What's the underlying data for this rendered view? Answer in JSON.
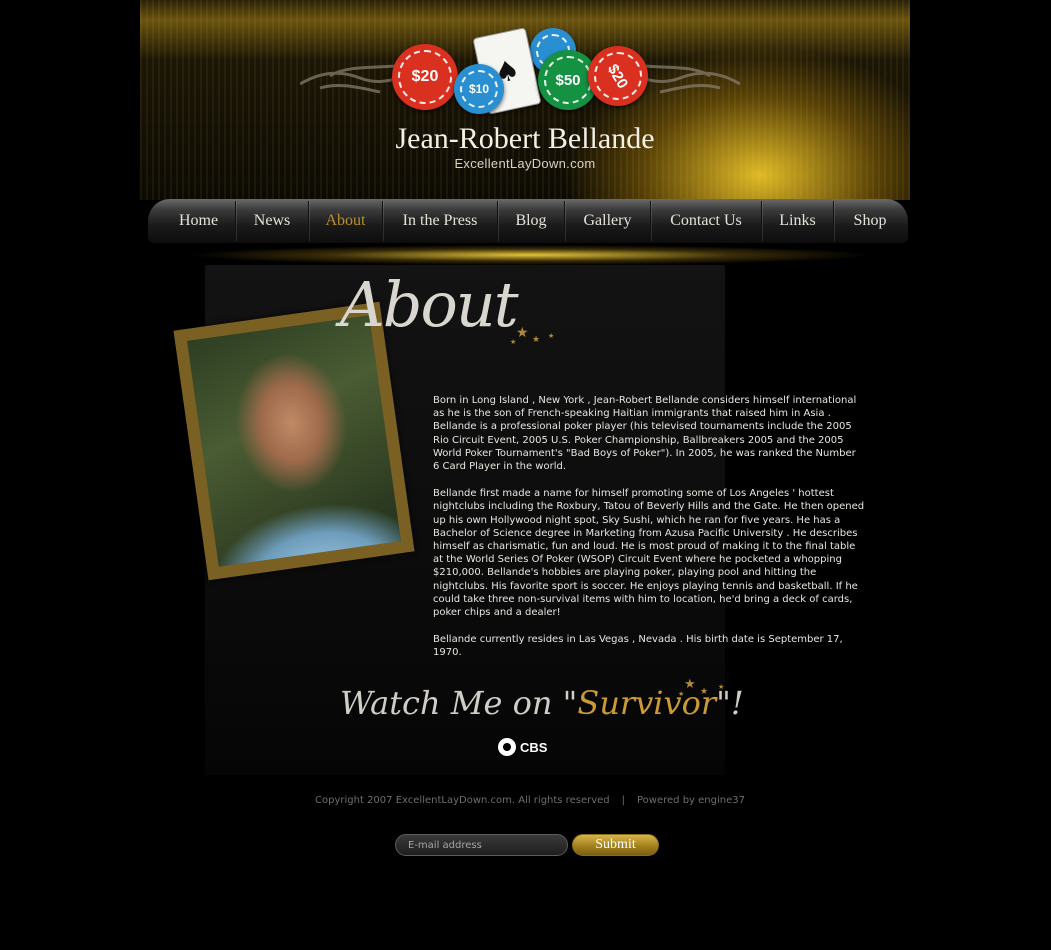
{
  "header": {
    "title": "Jean-Robert Bellande",
    "subtitle": "ExcellentLayDown.com",
    "chips": [
      "$20",
      "$10",
      "$50",
      "$20"
    ],
    "card_symbol": "♠"
  },
  "nav": {
    "items": [
      {
        "label": "Home",
        "active": false
      },
      {
        "label": "News",
        "active": false
      },
      {
        "label": "About",
        "active": true
      },
      {
        "label": "In the Press",
        "active": false
      },
      {
        "label": "Blog",
        "active": false
      },
      {
        "label": "Gallery",
        "active": false
      },
      {
        "label": "Contact Us",
        "active": false
      },
      {
        "label": "Links",
        "active": false
      },
      {
        "label": "Shop",
        "active": false
      }
    ]
  },
  "about": {
    "heading": "About",
    "paragraphs": [
      "Born in Long Island , New York ,  Jean-Robert Bellande considers himself international as he is the son of French-speaking Haitian immigrants that raised him in Asia .  Bellande is a professional poker player (his televised tournaments include the 2005 Rio Circuit Event, 2005 U.S. Poker Championship, Ballbreakers 2005 and the 2005 World Poker Tournament's \"Bad Boys of Poker\").  In 2005, he was ranked the Number 6 Card Player in the world.",
      "Bellande first made a name for himself promoting some of Los Angeles ' hottest nightclubs including the Roxbury, Tatou of Beverly Hills and the Gate.  He then opened up his own Hollywood night spot, Sky Sushi, which he ran for five years.  He has a Bachelor of Science degree in Marketing from Azusa Pacific University .  He describes himself as charismatic, fun and loud.  He is most proud of making it to the final table at the World Series Of Poker (WSOP) Circuit Event where he pocketed a whopping $210,000.  Bellande's hobbies are playing poker, playing pool and hitting the nightclubs.  His favorite sport is soccer.  He enjoys playing tennis and basketball.  If he could take three non-survival items with him to location, he'd bring a deck of cards, poker chips and a dealer!",
      " Bellande currently resides in Las Vegas , Nevada .  His birth date is September 17, 1970."
    ]
  },
  "promo": {
    "text_before": "Watch Me on \"",
    "show": "Survivor",
    "text_after": "\"!",
    "network": "CBS"
  },
  "footer": {
    "copyright": "Copyright 2007 ExcellentLayDown.com. All rights reserved",
    "separator": "|",
    "powered": "Powered by engine37"
  },
  "newsletter": {
    "placeholder": "E-mail address",
    "submit_label": "Submit"
  },
  "colors": {
    "accent_gold": "#b8902e",
    "background": "#000000"
  }
}
